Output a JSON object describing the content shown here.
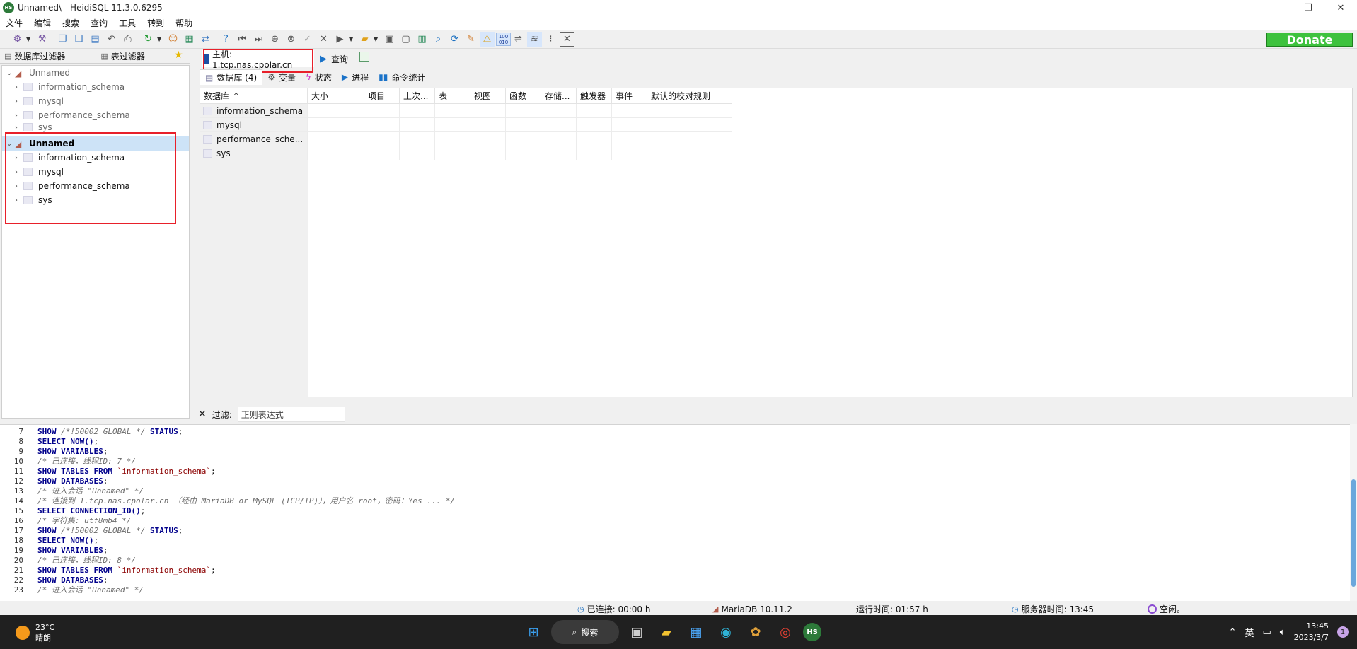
{
  "window": {
    "title": "Unnamed\\ - HeidiSQL 11.3.0.6295",
    "app_icon": "HS",
    "controls": [
      "–",
      "❐",
      "✕"
    ]
  },
  "menu": [
    "文件",
    "编辑",
    "搜索",
    "查询",
    "工具",
    "转到",
    "帮助"
  ],
  "toolbar": {
    "donate_label": "Donate"
  },
  "left_panel": {
    "tabs": [
      "数据库过滤器",
      "表过滤器"
    ],
    "tree": [
      {
        "label": "Unnamed",
        "type": "server",
        "expanded": true,
        "selected": false,
        "muted": true
      },
      {
        "label": "information_schema",
        "type": "db",
        "muted": true
      },
      {
        "label": "mysql",
        "type": "db",
        "muted": true
      },
      {
        "label": "performance_schema",
        "type": "db",
        "muted": true
      },
      {
        "label": "sys",
        "type": "db",
        "muted": true
      },
      {
        "label": "Unnamed",
        "type": "server",
        "expanded": true,
        "selected": true
      },
      {
        "label": "information_schema",
        "type": "db"
      },
      {
        "label": "mysql",
        "type": "db"
      },
      {
        "label": "performance_schema",
        "type": "db"
      },
      {
        "label": "sys",
        "type": "db"
      }
    ]
  },
  "main_tabs": {
    "host_tab": "主机: 1.tcp.nas.cpolar.cn",
    "query_tab": "查询"
  },
  "sub_tabs": [
    "数据库 (4)",
    "变量",
    "状态",
    "进程",
    "命令统计"
  ],
  "grid": {
    "columns": [
      "数据库",
      "大小",
      "项目",
      "上次...",
      "表",
      "视图",
      "函数",
      "存储...",
      "触发器",
      "事件",
      "默认的校对规则"
    ],
    "rows": [
      "information_schema",
      "mysql",
      "performance_sche...",
      "sys"
    ]
  },
  "filter": {
    "label": "过滤:",
    "placeholder": "正则表达式"
  },
  "log": {
    "lines": [
      {
        "n": "7",
        "parts": [
          [
            "kw",
            "SHOW "
          ],
          [
            "cm",
            "/*!50002 GLOBAL */"
          ],
          [
            "kw",
            " STATUS"
          ],
          [
            "pl",
            ";"
          ]
        ]
      },
      {
        "n": "8",
        "parts": [
          [
            "kw",
            "SELECT NOW()"
          ],
          [
            "pl",
            ";"
          ]
        ]
      },
      {
        "n": "9",
        "parts": [
          [
            "kw",
            "SHOW VARIABLES"
          ],
          [
            "pl",
            ";"
          ]
        ]
      },
      {
        "n": "10",
        "parts": [
          [
            "cm",
            "/* 已连接，线程ID: 7 */"
          ]
        ]
      },
      {
        "n": "11",
        "parts": [
          [
            "kw",
            "SHOW TABLES FROM "
          ],
          [
            "st",
            "`information_schema`"
          ],
          [
            "pl",
            ";"
          ]
        ]
      },
      {
        "n": "12",
        "parts": [
          [
            "kw",
            "SHOW DATABASES"
          ],
          [
            "pl",
            ";"
          ]
        ]
      },
      {
        "n": "13",
        "parts": [
          [
            "cm",
            "/* 进入会话 \"Unnamed\" */"
          ]
        ]
      },
      {
        "n": "14",
        "parts": [
          [
            "cm",
            "/* 连接到 1.tcp.nas.cpolar.cn （经由 MariaDB or MySQL (TCP/IP)），用户名 root，密码：Yes ... */"
          ]
        ]
      },
      {
        "n": "15",
        "parts": [
          [
            "kw",
            "SELECT CONNECTION_ID()"
          ],
          [
            "pl",
            ";"
          ]
        ]
      },
      {
        "n": "16",
        "parts": [
          [
            "cm",
            "/* 字符集: utf8mb4 */"
          ]
        ]
      },
      {
        "n": "17",
        "parts": [
          [
            "kw",
            "SHOW "
          ],
          [
            "cm",
            "/*!50002 GLOBAL */"
          ],
          [
            "kw",
            " STATUS"
          ],
          [
            "pl",
            ";"
          ]
        ]
      },
      {
        "n": "18",
        "parts": [
          [
            "kw",
            "SELECT NOW()"
          ],
          [
            "pl",
            ";"
          ]
        ]
      },
      {
        "n": "19",
        "parts": [
          [
            "kw",
            "SHOW VARIABLES"
          ],
          [
            "pl",
            ";"
          ]
        ]
      },
      {
        "n": "20",
        "parts": [
          [
            "cm",
            "/* 已连接，线程ID: 8 */"
          ]
        ]
      },
      {
        "n": "21",
        "parts": [
          [
            "kw",
            "SHOW TABLES FROM "
          ],
          [
            "st",
            "`information_schema`"
          ],
          [
            "pl",
            ";"
          ]
        ]
      },
      {
        "n": "22",
        "parts": [
          [
            "kw",
            "SHOW DATABASES"
          ],
          [
            "pl",
            ";"
          ]
        ]
      },
      {
        "n": "23",
        "parts": [
          [
            "cm",
            "/* 进入会话 \"Unnamed\" */"
          ]
        ]
      }
    ]
  },
  "statusbar": {
    "connected": "已连接: 00:00 h",
    "server": "MariaDB 10.11.2",
    "uptime": "运行时间: 01:57 h",
    "server_time": "服务器时间: 13:45",
    "idle": "空闲。"
  },
  "taskbar": {
    "temp": "23°C",
    "weather": "晴朗",
    "search": "搜索",
    "ime": "英",
    "time": "13:45",
    "date": "2023/3/7",
    "notifications": "1"
  },
  "colors": {
    "highlight_box": "#e8202a",
    "selection": "#cde3f7",
    "donate": "#3ec23e"
  }
}
